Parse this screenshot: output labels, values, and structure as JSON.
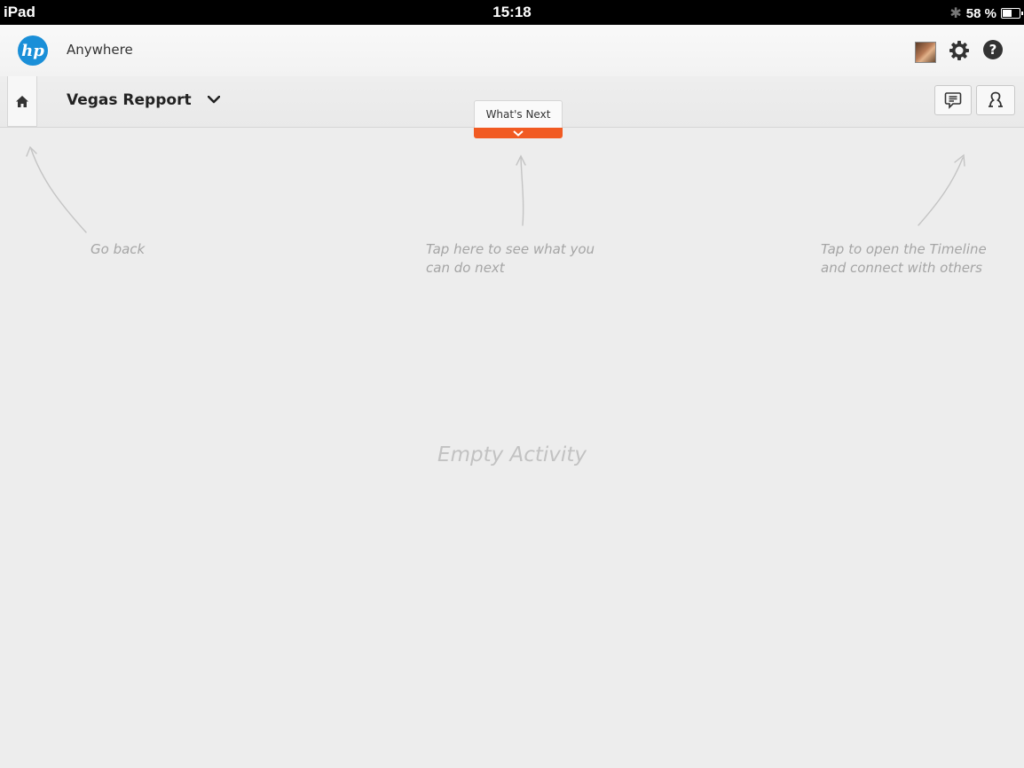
{
  "status_bar": {
    "device": "iPad",
    "time": "15:18",
    "battery_percent": "58 %",
    "battery_level": 0.58
  },
  "header": {
    "logo_text": "hp",
    "app_name": "Anywhere",
    "icons": [
      "avatar",
      "gear-icon",
      "help-icon"
    ],
    "help_glyph": "?"
  },
  "context_bar": {
    "title": "Vegas Repport",
    "whats_next_label": "What's Next",
    "accent_color": "#f15a22"
  },
  "hints": {
    "back": "Go back",
    "next": [
      "Tap here to see what you",
      "can do next"
    ],
    "timeline": [
      "Tap to open the Timeline",
      "and connect with others"
    ]
  },
  "main": {
    "empty_message": "Empty Activity"
  }
}
